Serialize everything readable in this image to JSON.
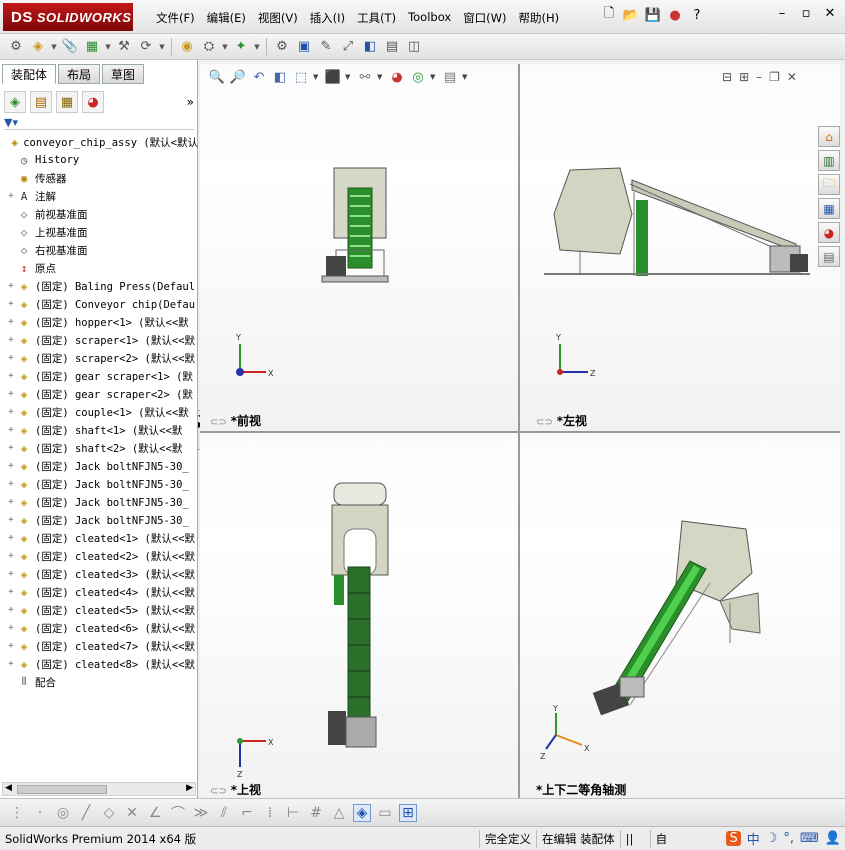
{
  "app": {
    "logo_text": "SOLIDWORKS"
  },
  "menu": [
    "文件(F)",
    "编辑(E)",
    "视图(V)",
    "插入(I)",
    "工具(T)",
    "Toolbox",
    "窗口(W)",
    "帮助(H)"
  ],
  "panel": {
    "tabs": [
      "装配体",
      "布局",
      "草图"
    ],
    "tree": [
      {
        "label": "conveyor_chip_assy  (默认<默认",
        "icon": "assembly-icon",
        "expand": ""
      },
      {
        "label": "History",
        "icon": "history-icon",
        "expand": ""
      },
      {
        "label": "传感器",
        "icon": "sensor-icon",
        "expand": ""
      },
      {
        "label": "注解",
        "icon": "annotation-icon",
        "expand": "+"
      },
      {
        "label": "前视基准面",
        "icon": "plane-icon",
        "expand": ""
      },
      {
        "label": "上视基准面",
        "icon": "plane-icon",
        "expand": ""
      },
      {
        "label": "右视基准面",
        "icon": "plane-icon",
        "expand": ""
      },
      {
        "label": "原点",
        "icon": "origin-icon",
        "expand": ""
      },
      {
        "label": "(固定) Baling Press(Defaul",
        "icon": "part-icon",
        "expand": "+"
      },
      {
        "label": "(固定) Conveyor chip(Defau",
        "icon": "part-icon",
        "expand": "+"
      },
      {
        "label": "(固定) hopper<1> (默认<<默",
        "icon": "part-icon",
        "expand": "+"
      },
      {
        "label": "(固定) scraper<1> (默认<<默",
        "icon": "part-icon",
        "expand": "+"
      },
      {
        "label": "(固定) scraper<2> (默认<<默",
        "icon": "part-icon",
        "expand": "+"
      },
      {
        "label": "(固定) gear scraper<1> (默",
        "icon": "part-icon",
        "expand": "+"
      },
      {
        "label": "(固定) gear scraper<2> (默",
        "icon": "part-icon",
        "expand": "+"
      },
      {
        "label": "(固定) couple<1> (默认<<默",
        "icon": "part-icon",
        "expand": "+"
      },
      {
        "label": "(固定) shaft<1> (默认<<默",
        "icon": "part-icon",
        "expand": "+"
      },
      {
        "label": "(固定) shaft<2> (默认<<默",
        "icon": "part-icon",
        "expand": "+"
      },
      {
        "label": "(固定) Jack boltNFJN5-30_",
        "icon": "part-icon",
        "expand": "+"
      },
      {
        "label": "(固定) Jack boltNFJN5-30_",
        "icon": "part-icon",
        "expand": "+"
      },
      {
        "label": "(固定) Jack boltNFJN5-30_",
        "icon": "part-icon",
        "expand": "+"
      },
      {
        "label": "(固定) Jack boltNFJN5-30_",
        "icon": "part-icon",
        "expand": "+"
      },
      {
        "label": "(固定) cleated<1> (默认<<默",
        "icon": "part-icon",
        "expand": "+"
      },
      {
        "label": "(固定) cleated<2> (默认<<默",
        "icon": "part-icon",
        "expand": "+"
      },
      {
        "label": "(固定) cleated<3> (默认<<默",
        "icon": "part-icon",
        "expand": "+"
      },
      {
        "label": "(固定) cleated<4> (默认<<默",
        "icon": "part-icon",
        "expand": "+"
      },
      {
        "label": "(固定) cleated<5> (默认<<默",
        "icon": "part-icon",
        "expand": "+"
      },
      {
        "label": "(固定) cleated<6> (默认<<默",
        "icon": "part-icon",
        "expand": "+"
      },
      {
        "label": "(固定) cleated<7> (默认<<默",
        "icon": "part-icon",
        "expand": "+"
      },
      {
        "label": "(固定) cleated<8> (默认<<默",
        "icon": "part-icon",
        "expand": "+"
      },
      {
        "label": "配合",
        "icon": "mates-icon",
        "expand": ""
      }
    ]
  },
  "viewports": {
    "front": "*前视",
    "left": "*左视",
    "top": "*上视",
    "iso": "*上下二等角轴测"
  },
  "axes": {
    "x": "X",
    "y": "Y",
    "z": "Z"
  },
  "status": {
    "product": "SolidWorks Premium 2014 x64 版",
    "defined": "完全定义",
    "editing": "在编辑 装配体",
    "custom": "自"
  },
  "colors": {
    "conveyor_green": "#2a8f2a",
    "belt_light": "#4fd04f",
    "frame": "#c9c9b8",
    "logo_red": "#b01515"
  }
}
